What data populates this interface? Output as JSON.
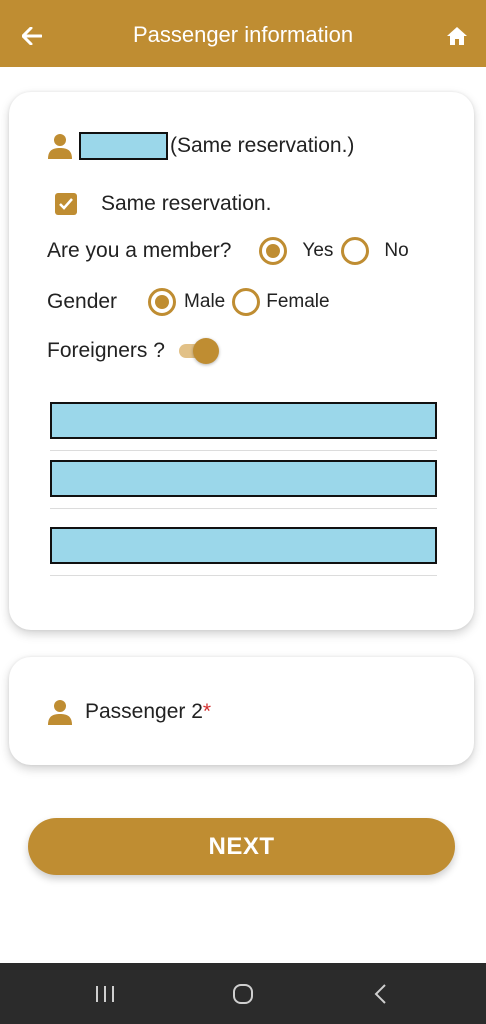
{
  "header": {
    "title": "Passenger information",
    "back_icon": "arrow-left-icon",
    "home_icon": "home-icon",
    "bg_color": "#bf8d32"
  },
  "passenger1": {
    "name_suffix": "(Same reservation.)",
    "same_reservation_label": "Same reservation.",
    "same_reservation_checked": true,
    "member_question": "Are you a member?",
    "member_yes": "Yes",
    "member_no": "No",
    "member_selected": "Yes",
    "gender_label": "Gender",
    "gender_male": "Male",
    "gender_female": "Female",
    "gender_selected": "Male",
    "foreigners_label": "Foreigners ?",
    "foreigners_on": true
  },
  "passenger2": {
    "label": "Passenger 2",
    "required_mark": "*"
  },
  "next_button": "NEXT",
  "colors": {
    "accent": "#bf8d32",
    "redacted": "#9bd7ea",
    "required": "#d32f2f"
  }
}
